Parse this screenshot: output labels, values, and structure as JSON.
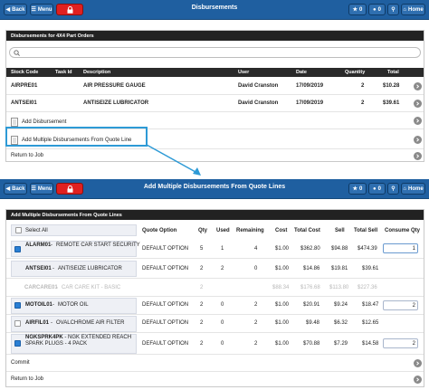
{
  "screen1": {
    "back_label": "Back",
    "menu_label": "Menu",
    "title": "Disbursements",
    "badge_messages": "0",
    "badge_users": "0",
    "home_label": "Home",
    "panel_title": "Disbursements for 4X4 Part Orders",
    "columns": [
      "Stock Code",
      "Task Id",
      "Description",
      "User",
      "Date",
      "Quantity",
      "Total"
    ],
    "rows": [
      {
        "stock_code": "AIRPRE01",
        "task_id": "",
        "description": "AIR PRESSURE GAUGE",
        "user": "David Cranston",
        "date": "17/09/2019",
        "quantity": "2",
        "total": "$10.28"
      },
      {
        "stock_code": "ANTSEI01",
        "task_id": "",
        "description": "ANTISEIZE LUBRICATOR",
        "user": "David Cranston",
        "date": "17/09/2019",
        "quantity": "2",
        "total": "$39.61"
      }
    ],
    "add_disbursement": "Add Disbursement",
    "add_multiple": "Add Multiple Disbursements From Quote Line",
    "return_to_job": "Return to Job"
  },
  "screen2": {
    "back_label": "Back",
    "menu_label": "Menu",
    "title": "Add Multiple Disbursements From Quote Lines",
    "badge_messages": "0",
    "badge_users": "0",
    "home_label": "Home",
    "panel_title": "Add Multiple Disbursements From Quote Lines",
    "select_all": "Select All",
    "columns": [
      "Quote Option",
      "Qty",
      "Used",
      "Remaining",
      "Cost",
      "Total Cost",
      "Sell",
      "Total Sell",
      "Consume Qty"
    ],
    "rows": [
      {
        "checked": true,
        "disabled": false,
        "boxed": true,
        "code": "ALARM01",
        "name": "REMOTE CAR START SECURITY",
        "option": "DEFAULT OPTION",
        "qty": "5",
        "used": "1",
        "remaining": "4",
        "cost": "$1.00",
        "total_cost": "$362.80",
        "sell": "$94.88",
        "total_sell": "$474.39",
        "consume": "1"
      },
      {
        "checked": false,
        "disabled": false,
        "boxed": true,
        "code": "ANTSEI01",
        "name": "ANTISEIZE LUBRICATOR",
        "option": "DEFAULT OPTION",
        "qty": "2",
        "used": "2",
        "remaining": "0",
        "cost": "$1.00",
        "total_cost": "$14.86",
        "sell": "$19.81",
        "total_sell": "$39.61",
        "consume": ""
      },
      {
        "checked": false,
        "disabled": true,
        "boxed": false,
        "code": "CARCARE01",
        "name": "CAR CARE KIT - BASIC",
        "option": "",
        "qty": "2",
        "used": "",
        "remaining": "",
        "cost": "$88.34",
        "total_cost": "$176.68",
        "sell": "$113.80",
        "total_sell": "$227.36",
        "consume": ""
      },
      {
        "checked": true,
        "disabled": false,
        "boxed": true,
        "code": "MOTOIL01",
        "name": "MOTOR OIL",
        "option": "DEFAULT OPTION",
        "qty": "2",
        "used": "0",
        "remaining": "2",
        "cost": "$1.00",
        "total_cost": "$20.91",
        "sell": "$9.24",
        "total_sell": "$18.47",
        "consume": "2"
      },
      {
        "checked": false,
        "disabled": false,
        "boxed": true,
        "code": "AIRFIL01",
        "name": "OVALCHROME AIR FILTER",
        "option": "DEFAULT OPTION",
        "qty": "2",
        "used": "0",
        "remaining": "2",
        "cost": "$1.00",
        "total_cost": "$9.48",
        "sell": "$6.32",
        "total_sell": "$12.65",
        "consume": ""
      },
      {
        "checked": true,
        "disabled": false,
        "boxed": true,
        "code": "NGKSPRK4PK",
        "name": "NGK EXTENDED REACH SPARK PLUGS - 4 PACK",
        "option": "DEFAULT OPTION",
        "qty": "2",
        "used": "0",
        "remaining": "2",
        "cost": "$1.00",
        "total_cost": "$70.88",
        "sell": "$7.29",
        "total_sell": "$14.58",
        "consume": "2"
      }
    ],
    "commit": "Commit",
    "return_to_job": "Return to Job"
  },
  "colors": {
    "topbar": "#1f5fa0",
    "lock_button": "#e02020",
    "highlight": "#2d9ad6",
    "checkbox": "#2a7fd4"
  }
}
